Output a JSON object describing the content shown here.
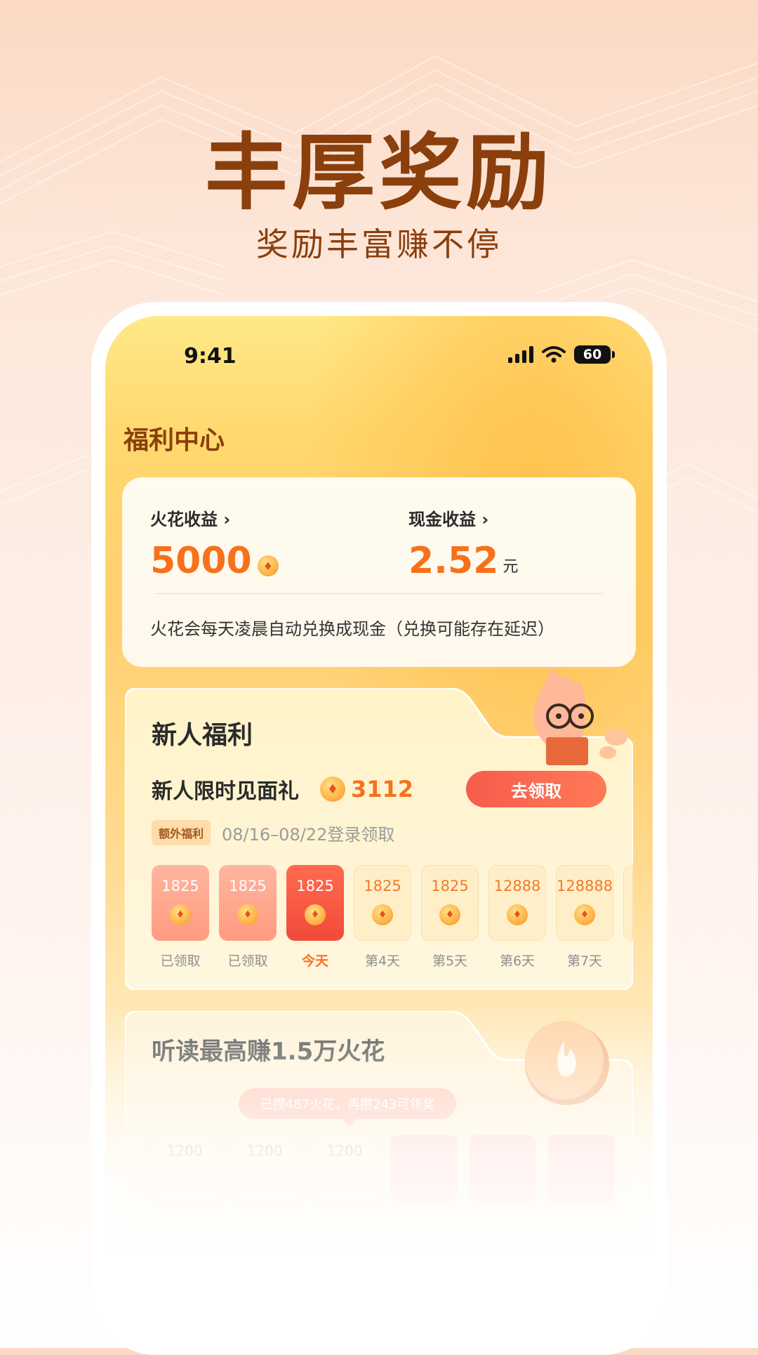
{
  "promo": {
    "headline": "丰厚奖励",
    "subline": "奖励丰富赚不停"
  },
  "status_bar": {
    "time": "9:41",
    "battery": "60"
  },
  "page": {
    "title": "福利中心"
  },
  "earnings": {
    "spark_label": "火花收益",
    "spark_value": "5000",
    "cash_label": "现金收益",
    "cash_value": "2.52",
    "cash_unit": "元",
    "note": "火花会每天凌晨自动兑换成现金（兑换可能存在延迟）"
  },
  "newbie": {
    "title": "新人福利",
    "gift_label": "新人限时见面礼",
    "gift_amount": "3112",
    "claim_button": "去领取",
    "extra_badge": "额外福利",
    "date_range": "08/16–08/22登录领取",
    "days": [
      {
        "value": "1825",
        "label": "已领取",
        "state": "claimed"
      },
      {
        "value": "1825",
        "label": "已领取",
        "state": "claimed"
      },
      {
        "value": "1825",
        "label": "今天",
        "state": "today"
      },
      {
        "value": "1825",
        "label": "第4天",
        "state": "future"
      },
      {
        "value": "1825",
        "label": "第5天",
        "state": "future"
      },
      {
        "value": "12888",
        "label": "第6天",
        "state": "future"
      },
      {
        "value": "128888",
        "label": "第7天",
        "state": "future"
      }
    ]
  },
  "listen": {
    "title": "听读最高赚1.5万火花",
    "tooltip": "已攒487火花，再攒243可领奖",
    "boxes": [
      "1200",
      "1200",
      "1200"
    ]
  },
  "icons": {
    "status": [
      "signal-icon",
      "wifi-icon",
      "battery-icon"
    ],
    "arrows": "chevron-right-icon",
    "coin": "spark-coin-icon",
    "mascot": "flame-mascot-icon"
  },
  "colors": {
    "brand_brown": "#8a3f0c",
    "accent_orange": "#f7711c",
    "button_red": "#f75b4c"
  }
}
